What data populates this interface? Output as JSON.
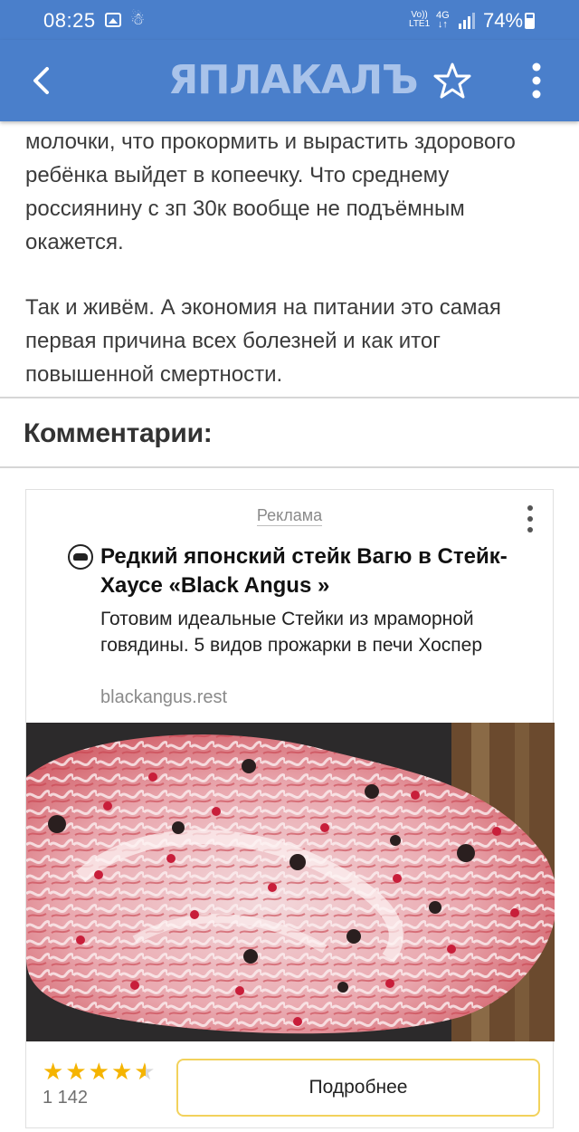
{
  "status_bar": {
    "time": "08:25",
    "volte": "Vo))\nLTE1",
    "network": "4G",
    "battery": "74%"
  },
  "app_bar": {
    "logo": "ЯПЛАКАЛЪ"
  },
  "article": {
    "paragraph1": "молочки, что прокормить и вырастить здорового ребёнка выйдет в копеечку. Что среднему россиянину с зп 30к вообще не подъёмным окажется.",
    "paragraph2": "Так и живём. А экономия на питании это самая первая причина всех болезней и как итог повышенной смертности."
  },
  "comments": {
    "title": "Комментарии:"
  },
  "ad": {
    "label": "Реклама",
    "title": "Редкий японский стейк Вагю в Стейк-Хаусе «Black Angus »",
    "description": "Готовим идеальные Стейки из мраморной говядины. 5 видов прожарки в печи Хоспер",
    "domain": "blackangus.rest",
    "rating": 4.5,
    "rating_count": "1 142",
    "cta_label": "Подробнее"
  },
  "colors": {
    "app_bar": "#4a7fcb",
    "logo": "#a9c3ea",
    "star": "#f5b400",
    "cta_border": "#f2d25c"
  }
}
